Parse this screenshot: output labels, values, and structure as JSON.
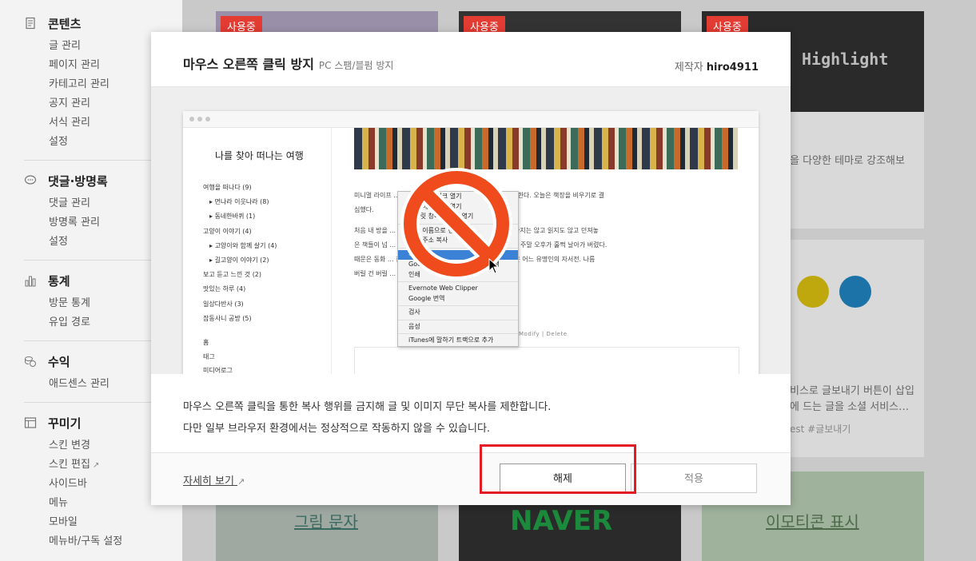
{
  "sidebar": {
    "groups": [
      {
        "title": "콘텐츠",
        "icon": "document-icon",
        "items": [
          "글 관리",
          "페이지 관리",
          "카테고리 관리",
          "공지 관리",
          "서식 관리",
          "설정"
        ]
      },
      {
        "title": "댓글·방명록",
        "icon": "speech-bubble-icon",
        "items": [
          "댓글 관리",
          "방명록 관리",
          "설정"
        ]
      },
      {
        "title": "통계",
        "icon": "bar-chart-icon",
        "items": [
          "방문 통계",
          "유입 경로"
        ]
      },
      {
        "title": "수익",
        "icon": "coins-icon",
        "items": [
          "애드센스 관리"
        ]
      },
      {
        "title": "꾸미기",
        "icon": "layout-icon",
        "items": [
          "스킨 변경",
          "스킨 편집",
          "사이드바",
          "메뉴",
          "모바일",
          "메뉴바/구독 설정"
        ]
      }
    ]
  },
  "background": {
    "badge": "사용중",
    "card_highlight_text": "Highlight",
    "card_desc_1": "을 다양한 테마로 강조해보",
    "card_desc_2a": "비스로 글보내기 버튼이 삽입",
    "card_desc_2b": "에 드는 글을 소셜 서비스…",
    "card_tags": "est  #글보내기",
    "card_bottom_1": "그림 문자",
    "card_bottom_2": "NAVER",
    "card_bottom_3": "이모티콘 표시"
  },
  "modal": {
    "title": "마우스 오른쪽 클릭 방지",
    "subtitle": "PC 스팸/블펌 방지",
    "author_label": "제작자",
    "author": "hiro4911",
    "description_line1": "마우스 오른쪽 클릭을 통한 복사 행위를 금지해 글 및 이미지 무단 복사를 제한합니다.",
    "description_line2": "다만 일부 브라우저 환경에서는 정상적으로 작동하지 않을 수 있습니다.",
    "detail_link": "자세히 보기",
    "release_button": "해제",
    "apply_button": "적용"
  },
  "preview": {
    "blog_title": "나를 찾아 떠나는 여행",
    "nav": [
      {
        "label": "여행을 떠나다 (9)",
        "sub": false
      },
      {
        "label": "먼나라 이웃나라 (8)",
        "sub": true
      },
      {
        "label": "동네한바퀴 (1)",
        "sub": true
      },
      {
        "label": "고양이 이야기 (4)",
        "sub": false
      },
      {
        "label": "고양이와 함께 살기 (4)",
        "sub": true
      },
      {
        "label": "길고양이 이야기 (2)",
        "sub": true
      },
      {
        "label": "보고 듣고 느낀 것 (2)",
        "sub": false
      },
      {
        "label": "맛있는 하루 (4)",
        "sub": false
      },
      {
        "label": "일상다반사 (3)",
        "sub": false
      },
      {
        "label": "잡동사니 공방 (5)",
        "sub": false
      }
    ],
    "nav_bottom": [
      "홈",
      "태그",
      "미디어로그"
    ],
    "text_line1": "미니멀 라이프 ... 고자 청소하는 과정을 하나하나 남겨놓을까 한다. 오늘은 책장을 비우기로 결",
    "text_line2": "심했다.",
    "text_line3": "처음 내 방을 ... 인 오 서재의 이미지였을 텐데. 몇 년간 정리하지는 않고 읽지도 않고 던져놓",
    "text_line4": "은 책들이 넘 ... 는 ... 로 책을 한 권 두 권 꺼내 분류하다 보니 주말 오후가 훌쩍 날아가 버렸다.",
    "text_line5": "때문은 동화 ... 짐 ... 과 숙제 때문에 한 번 읽고 펼쳐보지 않은 어느 유명인의 자서전. 나름",
    "text_line6": "버릴 건 버릴 ... 많을 줄이야.",
    "context_menu": [
      "새 탭에서 링크 열기",
      "새 창에서 링크 열기",
      "시크릿 창에서 링크 열기",
      "다른 이름으로 링크 저장",
      "링크 주소 복사",
      "복사",
      "Google에서 '미니멀 라이프' 검색",
      "인쇄",
      "Evernote Web Clipper",
      "Google 번역",
      "검사",
      "음성",
      "iTunes에 말하기 트랙으로 추가"
    ],
    "modify_delete": "Modify  |  Delete"
  }
}
